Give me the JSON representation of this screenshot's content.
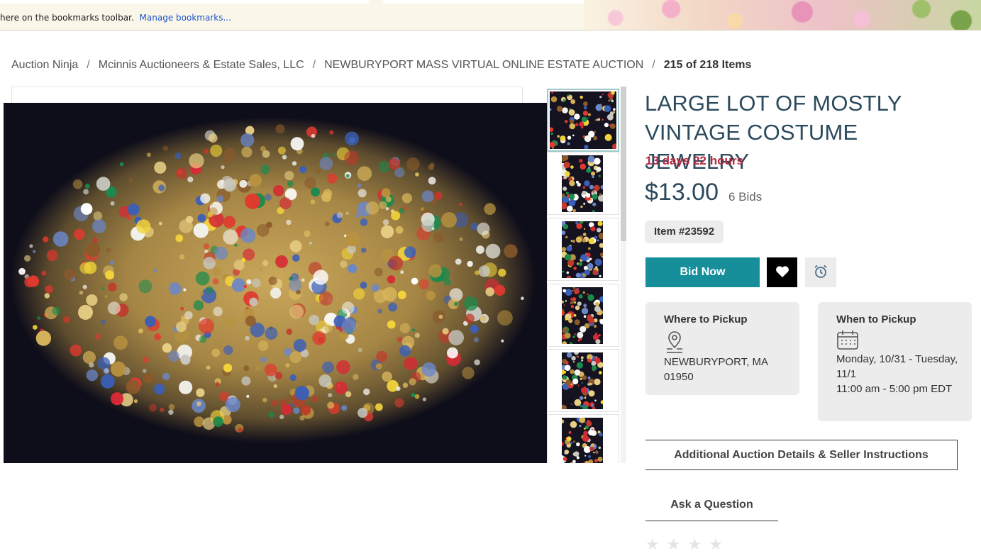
{
  "bookmarks_bar": {
    "message": "here on the bookmarks toolbar.",
    "link": "Manage bookmarks..."
  },
  "breadcrumb": [
    {
      "label": "Auction Ninja"
    },
    {
      "label": "Mcinnis Auctioneers & Estate Sales, LLC"
    },
    {
      "label": "NEWBURYPORT MASS VIRTUAL ONLINE ESTATE AUCTION"
    },
    {
      "label": "215 of 218 Items"
    }
  ],
  "item": {
    "title": "LARGE LOT OF MOSTLY VINTAGE COSTUME JEWELRY",
    "time_left": "13 days 22 hours",
    "price": "$13.00",
    "bids": "6 Bids",
    "item_number": "Item #23592",
    "bid_button": "Bid Now"
  },
  "pickup": {
    "where_title": "Where to Pickup",
    "where_text": "NEWBURYPORT, MA 01950",
    "when_title": "When to Pickup",
    "when_date": "Monday, 10/31 - Tuesday, 11/1",
    "when_time": "11:00 am - 5:00 pm EDT"
  },
  "actions": {
    "details": "Additional Auction Details & Seller Instructions",
    "ask": "Ask a Question"
  },
  "icons": {
    "favorite": "heart-icon",
    "watch": "alarm-clock-icon",
    "location": "map-pin-icon",
    "calendar": "calendar-icon"
  },
  "colors": {
    "accent": "#178f9b",
    "title": "#2b4a5c",
    "time_left": "#b0283f"
  }
}
